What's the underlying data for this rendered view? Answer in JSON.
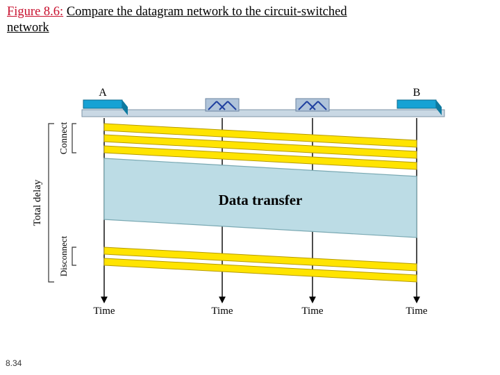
{
  "figure": {
    "label": "Figure 8.6:",
    "caption_part1": "Compare the datagram network to the circuit-switched",
    "caption_part2": "network"
  },
  "page_number": "8.34",
  "diagram": {
    "header_left": "A",
    "header_right": "B",
    "left_label_total": "Total delay",
    "left_label_connect": "Connect",
    "left_label_disconnect": "Disconnect",
    "center_label": "Data transfer",
    "bottom_label": "Time",
    "colors": {
      "host_top": "#17a2d4",
      "host_side": "#0e7aa0",
      "router_body": "#b0c4da",
      "router_line": "#2040a0",
      "connect_band": "#ffe400",
      "connect_edge": "#b59a00",
      "data_fill": "#bcdce5",
      "data_edge": "#7aa9b3",
      "rail_fill": "#c9d8e4",
      "rail_edge": "#7d93a6",
      "bracket": "#333"
    }
  },
  "chart_data": {
    "type": "diagram",
    "title": "Compare the datagram network to the circuit-switched network",
    "nodes": [
      "A",
      "Router1",
      "Router2",
      "B"
    ],
    "phases": [
      {
        "name": "Connect",
        "bands": 3,
        "direction": "A→B"
      },
      {
        "name": "Data transfer",
        "bands": 1,
        "direction": "A→B"
      },
      {
        "name": "Disconnect",
        "bands": 2,
        "direction": "A→B"
      }
    ],
    "x_axis_label": "Time",
    "total_delay_bracket": [
      "Connect",
      "Data transfer",
      "Disconnect"
    ]
  }
}
